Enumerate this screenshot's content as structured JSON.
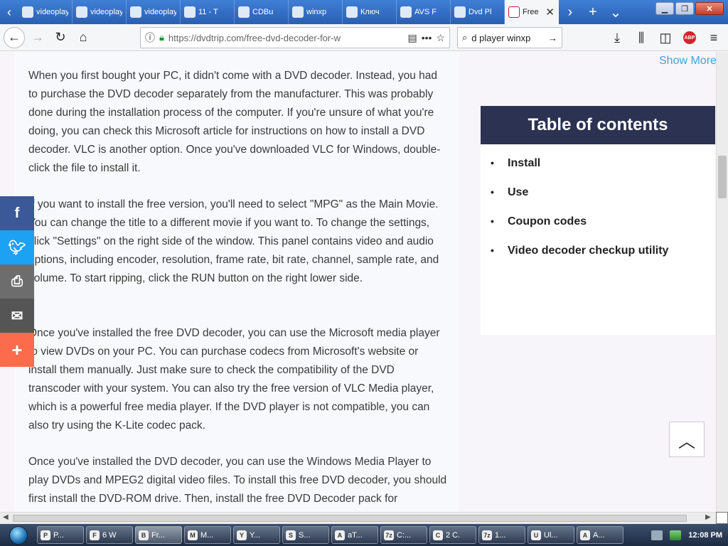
{
  "browser": {
    "tabs": [
      {
        "title": "videoplayb",
        "icon": "page-icon"
      },
      {
        "title": "videoplayb",
        "icon": "page-icon"
      },
      {
        "title": "videoplayb",
        "icon": "page-icon"
      },
      {
        "title": "11 - T",
        "icon": "shield-icon"
      },
      {
        "title": "CDBu",
        "icon": "globe-icon"
      },
      {
        "title": "winxp",
        "icon": "w-icon"
      },
      {
        "title": "Ключ",
        "icon": "circle-icon"
      },
      {
        "title": "AVS F",
        "icon": "avs-icon"
      },
      {
        "title": "Dvd Pl",
        "icon": "check-icon"
      },
      {
        "title": "Free",
        "icon": "d-icon",
        "active": true
      }
    ],
    "url": "https://dvdtrip.com/free-dvd-decoder-for-w",
    "search_value": "d player winxp"
  },
  "page": {
    "show_more": "Show More",
    "paragraphs": [
      "When you first bought your PC, it didn't come with a DVD decoder. Instead, you had to purchase the DVD decoder separately from the manufacturer. This was probably done during the installation process of the computer. If you're unsure of what you're doing, you can check this Microsoft article for instructions on how to install a DVD decoder. VLC is another option. Once you've downloaded VLC for Windows, double-click the file to install it.",
      "If you want to install the free version, you'll need to select \"MPG\" as the Main Movie. You can change the title to a different movie if you want to. To change the settings, click \"Settings\" on the right side of the window. This panel contains video and audio options, including encoder, resolution, frame rate, bit rate, channel, sample rate, and volume. To start ripping, click the RUN button on the right lower side.",
      "Once you've installed the free DVD decoder, you can use the Microsoft media player to view DVDs on your PC. You can purchase codecs from Microsoft's website or install them manually. Just make sure to check the compatibility of the DVD transcoder with your system. You can also try the free version of VLC Media player, which is a powerful free media player. If the DVD player is not compatible, you can also try using the K-Lite codec pack.",
      "Once you've installed the DVD decoder, you can use the Windows Media Player to play DVDs and MPEG2 digital video files. To install this free DVD decoder, you should first install the DVD-ROM drive. Then, install the free DVD Decoder pack for"
    ],
    "toc": {
      "title": "Table of contents",
      "items": [
        "Install",
        "Use",
        "Coupon codes",
        "Video decoder checkup utility"
      ]
    }
  },
  "taskbar": {
    "tasks": [
      {
        "label": "P...",
        "icon": "P"
      },
      {
        "label": "6 W",
        "icon": "F"
      },
      {
        "label": "Fr...",
        "icon": "B",
        "active": true
      },
      {
        "label": "M...",
        "icon": "M"
      },
      {
        "label": "Y...",
        "icon": "Y"
      },
      {
        "label": "S...",
        "icon": "S"
      },
      {
        "label": "aT...",
        "icon": "A"
      },
      {
        "label": "C:...",
        "icon": "7z"
      },
      {
        "label": "2 C.",
        "icon": "C"
      },
      {
        "label": "1...",
        "icon": "7z"
      },
      {
        "label": "Ul...",
        "icon": "U"
      },
      {
        "label": "A...",
        "icon": "A"
      }
    ],
    "clock": "12:08 PM"
  }
}
